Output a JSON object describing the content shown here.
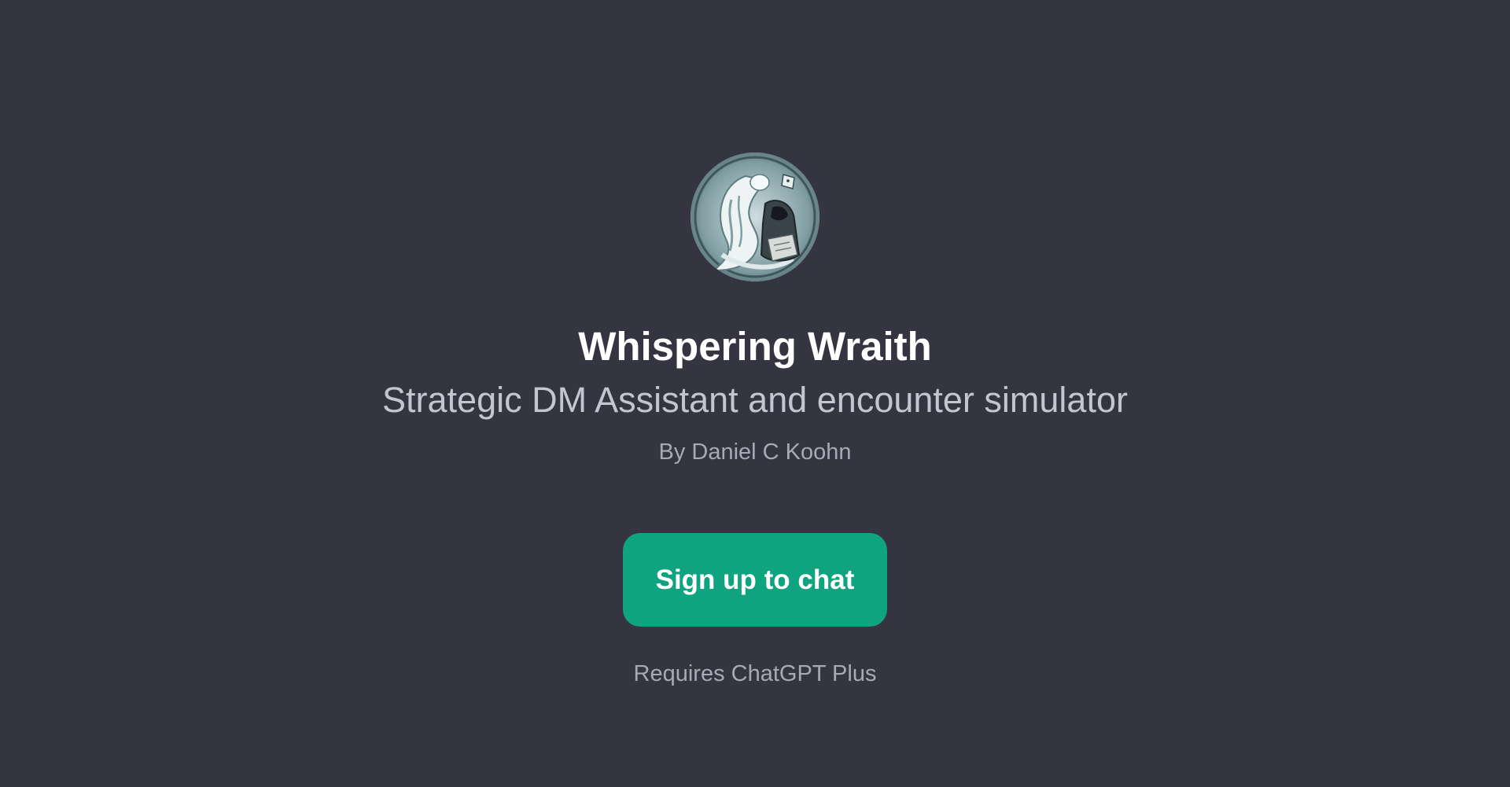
{
  "gpt": {
    "avatar_icon": "wraith-portrait-icon",
    "name": "Whispering Wraith",
    "description": "Strategic DM Assistant and encounter simulator",
    "author": "By Daniel C Koohn"
  },
  "actions": {
    "signup_label": "Sign up to chat",
    "requirement_note": "Requires ChatGPT Plus"
  },
  "colors": {
    "background": "#343541",
    "accent": "#10a37f",
    "title_text": "#ffffff",
    "subtitle_text": "#c5c5d2",
    "muted_text": "#a9a9b6"
  }
}
